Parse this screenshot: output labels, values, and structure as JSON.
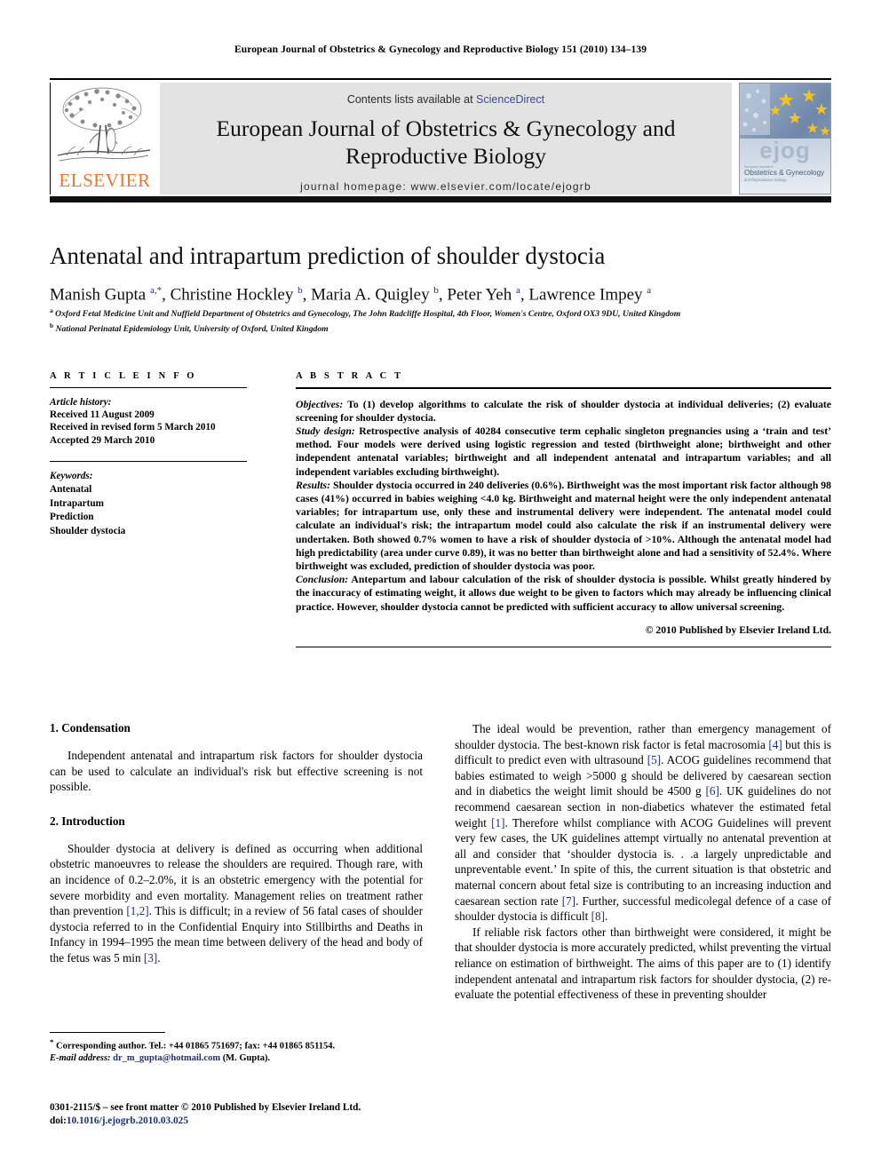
{
  "running_head": "European Journal of Obstetrics & Gynecology and Reproductive Biology 151 (2010) 134–139",
  "banner": {
    "contents_prefix": "Contents lists available at ",
    "sciencedirect": "ScienceDirect",
    "journal_title": "European Journal of Obstetrics & Gynecology and Reproductive Biology",
    "homepage": "journal homepage: www.elsevier.com/locate/ejogrb",
    "publisher_logo_text": "ELSEVIER",
    "cover_wordmark": "ejog",
    "cover_subtitle": "Obstetrics & Gynecology",
    "cover_subtitle2": "and Reproductive Biology",
    "logo_color": "#e8762c",
    "link_color": "#3b49a2"
  },
  "article": {
    "title": "Antenatal and intrapartum prediction of shoulder dystocia",
    "authors_html": "Manish Gupta <sup>a,*</sup>, Christine Hockley <sup>b</sup>, Maria A. Quigley <sup>b</sup>, Peter Yeh <sup>a</sup>, Lawrence Impey <sup>a</sup>",
    "affiliation_a": "Oxford Fetal Medicine Unit and Nuffield Department of Obstetrics and Gynecology, The John Radcliffe Hospital, 4th Floor, Women's Centre, Oxford OX3 9DU, United Kingdom",
    "affiliation_b": "National Perinatal Epidemiology Unit, University of Oxford, United Kingdom"
  },
  "article_info": {
    "heading": "A R T I C L E    I N F O",
    "history_label": "Article history:",
    "history": [
      "Received 11 August 2009",
      "Received in revised form 5 March 2010",
      "Accepted 29 March 2010"
    ],
    "keywords_label": "Keywords:",
    "keywords": [
      "Antenatal",
      "Intrapartum",
      "Prediction",
      "Shoulder dystocia"
    ]
  },
  "abstract": {
    "heading": "A B S T R A C T",
    "objectives_label": "Objectives:",
    "objectives": " To (1) develop algorithms to calculate the risk of shoulder dystocia at individual deliveries; (2) evaluate screening for shoulder dystocia.",
    "study_design_label": "Study design:",
    "study_design": " Retrospective analysis of 40284 consecutive term cephalic singleton pregnancies using a ‘train and test’ method. Four models were derived using logistic regression and tested (birthweight alone; birthweight and other independent antenatal variables; birthweight and all independent antenatal and intrapartum variables; and all independent variables excluding birthweight).",
    "results_label": "Results:",
    "results": " Shoulder dystocia occurred in 240 deliveries (0.6%). Birthweight was the most important risk factor although 98 cases (41%) occurred in babies weighing <4.0 kg. Birthweight and maternal height were the only independent antenatal variables; for intrapartum use, only these and instrumental delivery were independent. The antenatal model could calculate an individual's risk; the intrapartum model could also calculate the risk if an instrumental delivery were undertaken. Both showed 0.7% women to have a risk of shoulder dystocia of >10%. Although the antenatal model had high predictability (area under curve 0.89), it was no better than birthweight alone and had a sensitivity of 52.4%. Where birthweight was excluded, prediction of shoulder dystocia was poor.",
    "conclusion_label": "Conclusion:",
    "conclusion": " Antepartum and labour calculation of the risk of shoulder dystocia is possible. Whilst greatly hindered by the inaccuracy of estimating weight, it allows due weight to be given to factors which may already be influencing clinical practice. However, shoulder dystocia cannot be predicted with sufficient accuracy to allow universal screening.",
    "copyright": "© 2010 Published by Elsevier Ireland Ltd."
  },
  "sections": {
    "condensation_heading": "1. Condensation",
    "condensation_p1": "Independent antenatal and intrapartum risk factors for shoulder dystocia can be used to calculate an individual's risk but effective screening is not possible.",
    "introduction_heading": "2. Introduction",
    "intro_p1_a": "Shoulder dystocia at delivery is defined as occurring when additional obstetric manoeuvres to release the shoulders are required. Though rare, with an incidence of 0.2–2.0%, it is an obstetric emergency with the potential for severe morbidity and even mortality. Management relies on treatment rather than prevention ",
    "intro_p1_ref1": "[1,2]",
    "intro_p1_b": ". This is difficult; in a review of 56 fatal cases of shoulder dystocia referred to in the Confidential Enquiry into Stillbirths and Deaths in Infancy in 1994–1995 the mean time between delivery of the head and body of the fetus was 5 min ",
    "intro_p1_ref2": "[3]",
    "intro_p1_c": ".",
    "intro_p2_a": "The ideal would be prevention, rather than emergency management of shoulder dystocia. The best-known risk factor is fetal macrosomia ",
    "intro_p2_ref4": "[4]",
    "intro_p2_b": " but this is difficult to predict even with ultrasound ",
    "intro_p2_ref5": "[5]",
    "intro_p2_c": ". ACOG guidelines recommend that babies estimated to weigh >5000 g should be delivered by caesarean section and in diabetics the weight limit should be 4500 g ",
    "intro_p2_ref6": "[6]",
    "intro_p2_d": ". UK guidelines do not recommend caesarean section in non-diabetics whatever the estimated fetal weight ",
    "intro_p2_ref1": "[1]",
    "intro_p2_e": ". Therefore whilst compliance with ACOG Guidelines will prevent very few cases, the UK guidelines attempt virtually no antenatal prevention at all and consider that ‘shoulder dystocia is. . .a largely unpredictable and unpreventable event.’ In spite of this, the current situation is that obstetric and maternal concern about fetal size is contributing to an increasing induction and caesarean section rate ",
    "intro_p2_ref7": "[7]",
    "intro_p2_f": ". Further, successful medicolegal defence of a case of shoulder dystocia is difficult ",
    "intro_p2_ref8": "[8]",
    "intro_p2_g": ".",
    "intro_p3": "If reliable risk factors other than birthweight were considered, it might be that shoulder dystocia is more accurately predicted, whilst preventing the virtual reliance on estimation of birthweight. The aims of this paper are to (1) identify independent antenatal and intrapartum risk factors for shoulder dystocia, (2) re-evaluate the potential effectiveness of these in preventing shoulder"
  },
  "footnotes": {
    "corresponding": "Corresponding author. Tel.: +44 01865 751697; fax: +44 01865 851154.",
    "email_label": "E-mail address:",
    "email": "dr_m_gupta@hotmail.com",
    "email_suffix": " (M. Gupta).",
    "issn_line": "0301-2115/$ – see front matter © 2010 Published by Elsevier Ireland Ltd.",
    "doi_label": "doi:",
    "doi": "10.1016/j.ejogrb.2010.03.025"
  }
}
